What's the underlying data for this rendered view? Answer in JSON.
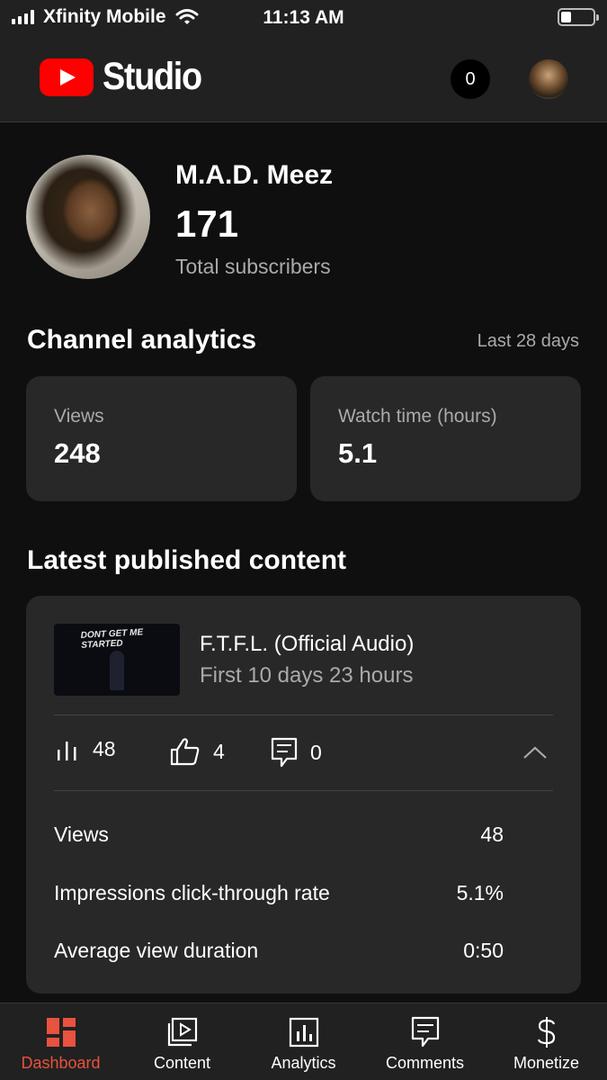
{
  "status_bar": {
    "carrier": "Xfinity Mobile",
    "time": "11:13 AM"
  },
  "header": {
    "app_name": "Studio",
    "notification_count": "0"
  },
  "channel": {
    "name": "M.A.D. Meez",
    "subscriber_count": "171",
    "subscriber_label": "Total subscribers"
  },
  "analytics": {
    "title": "Channel analytics",
    "range": "Last 28 days",
    "metrics": [
      {
        "label": "Views",
        "value": "248"
      },
      {
        "label": "Watch time (hours)",
        "value": "5.1"
      }
    ]
  },
  "latest": {
    "title": "Latest published content",
    "video": {
      "thumbnail_text": "DONT GET ME STARTED",
      "title": "F.T.F.L. (Official Audio)",
      "period": "First 10 days 23 hours",
      "views": "48",
      "likes": "4",
      "comments": "0"
    },
    "rows": [
      {
        "label": "Views",
        "value": "48"
      },
      {
        "label": "Impressions click-through rate",
        "value": "5.1%"
      },
      {
        "label": "Average view duration",
        "value": "0:50"
      }
    ]
  },
  "nav": {
    "accent": "#e8523f",
    "items": [
      {
        "label": "Dashboard",
        "icon": "dashboard-icon",
        "active": true
      },
      {
        "label": "Content",
        "icon": "content-icon"
      },
      {
        "label": "Analytics",
        "icon": "analytics-icon"
      },
      {
        "label": "Comments",
        "icon": "comments-icon"
      },
      {
        "label": "Monetize",
        "icon": "dollar-icon"
      }
    ]
  }
}
